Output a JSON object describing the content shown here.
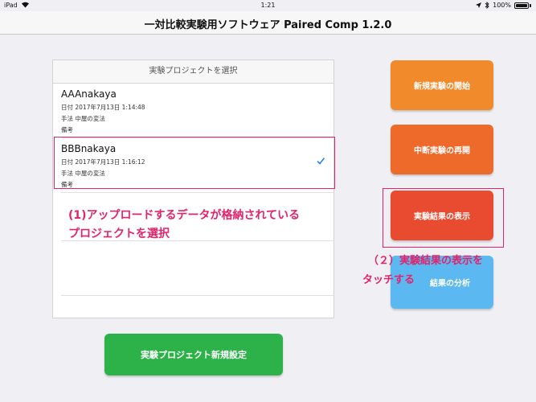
{
  "status_bar": {
    "device": "iPad",
    "time": "1:21",
    "battery": "100%"
  },
  "nav": {
    "title": "一対比較実験用ソフトウェア Paired Comp 1.2.0"
  },
  "table": {
    "header": "実験プロジェクトを選択",
    "rows": [
      {
        "name": "AAAnakaya",
        "date": "日付  2017年7月13日 1:14:48",
        "method": "手法  中屋の変法",
        "note": "備考",
        "selected": false
      },
      {
        "name": "BBBnakaya",
        "date": "日付  2017年7月13日 1:16:12",
        "method": "手法  中屋の変法",
        "note": "備考",
        "selected": true
      }
    ]
  },
  "annotations": {
    "step1_line1": "(1)アップロードするデータが格納されている",
    "step1_line2": "プロジェクトを選択",
    "step2_line1": "（２）実験結果の表示を",
    "step2_line2": "タッチする",
    "color": "#e2236b"
  },
  "buttons": {
    "new_experiment": {
      "label": "新規実験の開始",
      "color": "#f08a2a"
    },
    "resume_experiment": {
      "label": "中断実験の再開",
      "color": "#ee6a2a"
    },
    "show_results": {
      "label": "実験結果の表示",
      "color": "#e94b30"
    },
    "analyze_results": {
      "label": "結果の分析",
      "color": "#5bb8f0"
    },
    "new_project": {
      "label": "実験プロジェクト新規設定",
      "color": "#2db24a"
    }
  },
  "icons": [
    "wifi-icon",
    "location-icon",
    "bluetooth-icon",
    "battery-icon",
    "checkmark-icon"
  ]
}
